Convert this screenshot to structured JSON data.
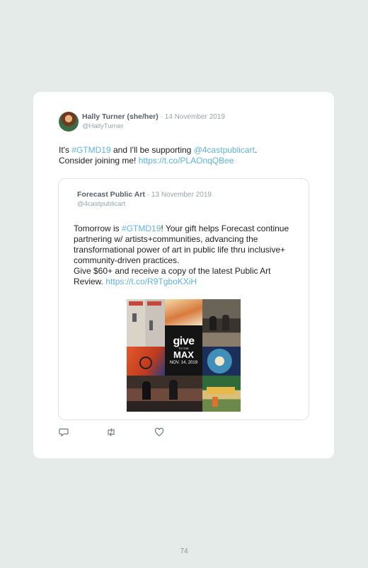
{
  "tweet": {
    "author_name": "Hally Turner (she/her)",
    "date": "· 14 November 2019",
    "handle": "@HallyTurner",
    "text_1": "It's ",
    "hashtag": "#GTMD19",
    "text_2": " and I'll be supporting ",
    "mention": "@4castpublicart",
    "text_3": ".",
    "text_4": "Consider joining me! ",
    "link": "https://t.co/PLAOnqQBee"
  },
  "quote": {
    "author_name": "Forecast Public Art",
    "date": "· 13 November 2019",
    "handle": "@4castpublicart",
    "text_1": "Tomorrow is ",
    "hashtag": "#GTMD19",
    "text_2": "! Your gift helps Forecast continue partnering w/ artists+communities, advancing the transformational power of art in public life thru inclusive+ community-driven practices.",
    "text_3": "Give $60+ and receive a copy of the latest Public Art Review. ",
    "link": "https://t.co/R9TgboKXiH",
    "image": {
      "give_word": "give",
      "to_the": "TO THE",
      "max_word": "MAX",
      "date": "NOV. 14, 2019"
    }
  },
  "actions": {
    "reply_icon": "reply-icon",
    "retweet_icon": "retweet-icon",
    "like_icon": "heart-icon"
  },
  "page_number": "74"
}
